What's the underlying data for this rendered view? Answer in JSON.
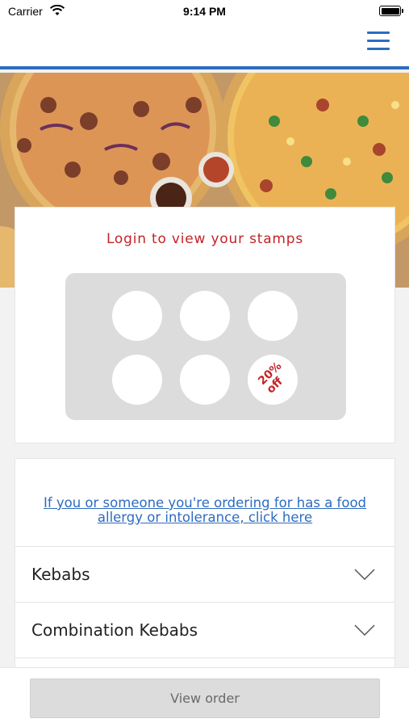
{
  "status_bar": {
    "carrier": "Carrier",
    "time": "9:14 PM"
  },
  "navbar": {
    "menu_icon": "hamburger-menu-icon",
    "accent_color": "#2d6cc0"
  },
  "hero": {
    "image": "pizza-photo"
  },
  "stamps": {
    "title": "Login to view your stamps",
    "reward_text_1": "20%",
    "reward_text_2": "off",
    "stamp_count": 6,
    "title_color": "#c42326"
  },
  "menu": {
    "allergy_line_1": "If you or someone you're ordering for has a food",
    "allergy_line_2": "allergy or intolerance, click here",
    "categories": [
      {
        "label": "Kebabs"
      },
      {
        "label": "Combination Kebabs"
      }
    ]
  },
  "footer": {
    "view_order_label": "View order"
  }
}
